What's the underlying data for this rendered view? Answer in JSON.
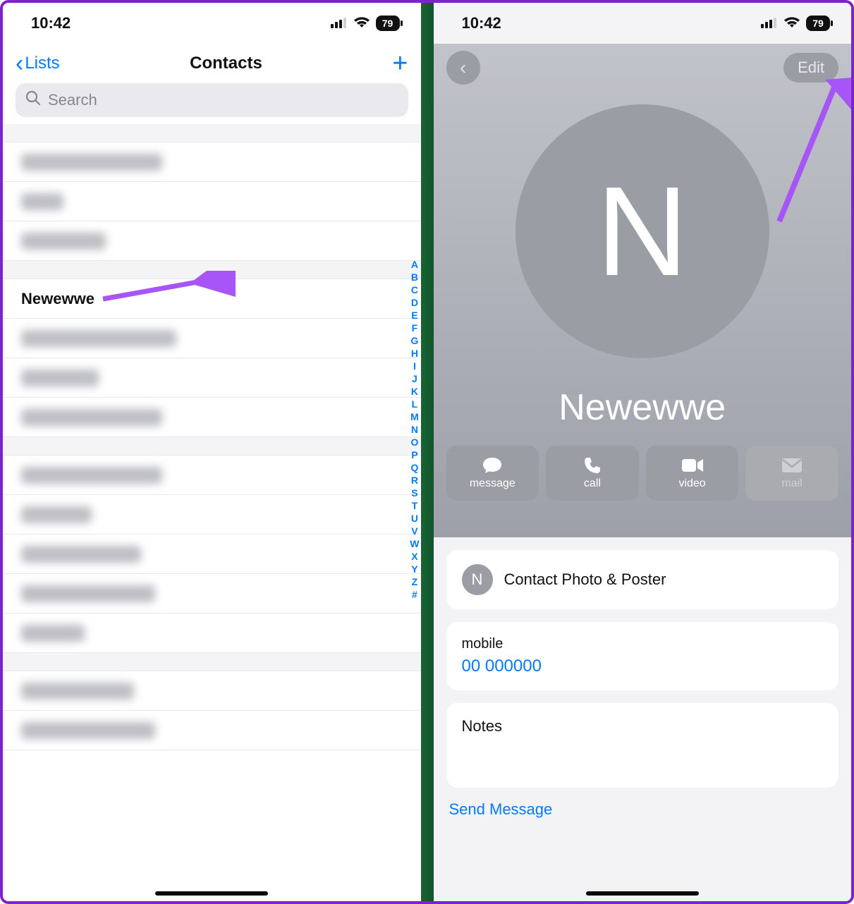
{
  "status": {
    "time": "10:42",
    "battery": "79"
  },
  "left": {
    "back_label": "Lists",
    "title": "Contacts",
    "search_placeholder": "Search",
    "visible_contact": "Newewwe",
    "index": [
      "A",
      "B",
      "C",
      "D",
      "E",
      "F",
      "G",
      "H",
      "I",
      "J",
      "K",
      "L",
      "M",
      "N",
      "O",
      "P",
      "Q",
      "R",
      "S",
      "T",
      "U",
      "V",
      "W",
      "X",
      "Y",
      "Z",
      "#"
    ]
  },
  "right": {
    "edit_label": "Edit",
    "avatar_initial": "N",
    "name": "Newewwe",
    "actions": {
      "message": "message",
      "call": "call",
      "video": "video",
      "mail": "mail"
    },
    "contact_photo_label": "Contact Photo & Poster",
    "mini_initial": "N",
    "phone_type": "mobile",
    "phone_number": "00 000000",
    "notes_label": "Notes",
    "send_message": "Send Message"
  }
}
